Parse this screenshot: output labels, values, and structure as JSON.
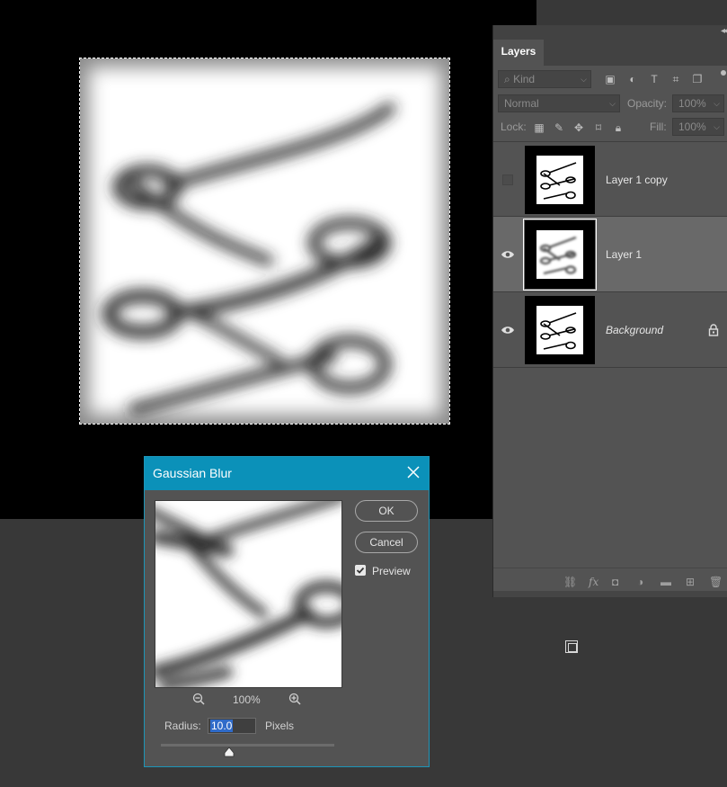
{
  "layers_panel": {
    "tab": "Layers",
    "filter_kind": "Kind",
    "blend_mode": "Normal",
    "opacity_label": "Opacity:",
    "opacity_value": "100%",
    "lock_label": "Lock:",
    "fill_label": "Fill:",
    "fill_value": "100%",
    "layers": [
      {
        "name": "Layer 1 copy",
        "visible": false,
        "selected": false,
        "locked": false,
        "italic": false
      },
      {
        "name": "Layer 1",
        "visible": true,
        "selected": true,
        "locked": false,
        "italic": false
      },
      {
        "name": "Background",
        "visible": true,
        "selected": false,
        "locked": true,
        "italic": true
      }
    ]
  },
  "gaussian_blur": {
    "title": "Gaussian Blur",
    "ok_label": "OK",
    "cancel_label": "Cancel",
    "preview_label": "Preview",
    "preview_checked": true,
    "zoom_level": "100%",
    "radius_label": "Radius:",
    "radius_value": "10.0",
    "radius_units": "Pixels"
  },
  "colors": {
    "accent": "#0b91b9",
    "panel_bg": "#535353",
    "workspace": "#383838",
    "selection_highlight": "#2f6bc9"
  }
}
